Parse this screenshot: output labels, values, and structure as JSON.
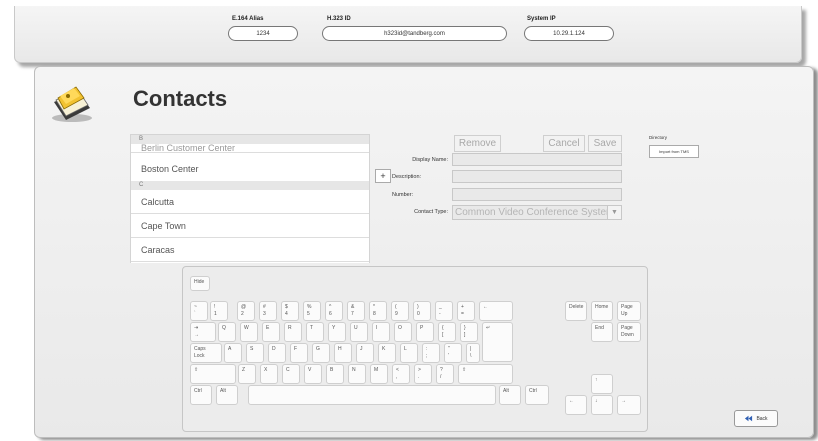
{
  "info_bar": {
    "e164_label": "E.164 Alias",
    "e164_value": "1234",
    "h323_label": "H.323 ID",
    "h323_value": "h323id@tandberg.com",
    "system_ip_label": "System IP",
    "system_ip_value": "10.29.1.124"
  },
  "page": {
    "title": "Contacts",
    "icon": "contacts-book-icon"
  },
  "contact_list": {
    "rows": [
      {
        "kind": "header",
        "text": "B"
      },
      {
        "kind": "item",
        "text": "Berlin Customer Center"
      },
      {
        "kind": "item",
        "text": "Boston Center"
      },
      {
        "kind": "header",
        "text": "C"
      },
      {
        "kind": "item",
        "text": "Calcutta"
      },
      {
        "kind": "item",
        "text": "Cape Town"
      },
      {
        "kind": "item",
        "text": "Caracas"
      }
    ]
  },
  "form": {
    "remove_label": "Remove",
    "cancel_label": "Cancel",
    "save_label": "Save",
    "add_label": "+",
    "display_name_label": "Display Name:",
    "display_name_value": "",
    "description_label": "Description:",
    "description_value": "",
    "number_label": "Number:",
    "number_value": "",
    "contact_type_label": "Contact Type:",
    "contact_type_value": "Common Video Conference System"
  },
  "directory": {
    "label": "Directory",
    "import_label": "Import from TMS"
  },
  "keyboard": {
    "hide_label": "Hide",
    "rows": [
      [
        "~\n`",
        "!\n1",
        "@\n2",
        "#\n3",
        "$\n4",
        "%\n5",
        "^\n6",
        "&\n7",
        "*\n8",
        "(\n9",
        ")\n0",
        "_\n-",
        "+\n=",
        "←"
      ],
      [
        "⇥\n→",
        "Q",
        "W",
        "E",
        "R",
        "T",
        "Y",
        "U",
        "I",
        "O",
        "P",
        "{\n[",
        "}\n]",
        "↵"
      ],
      [
        "Caps\nLock",
        "A",
        "S",
        "D",
        "F",
        "G",
        "H",
        "J",
        "K",
        "L",
        ":\n;",
        "\"\n'",
        "|\n\\"
      ],
      [
        "⇧",
        "Z",
        "X",
        "C",
        "V",
        "B",
        "N",
        "M",
        "<\n,",
        ">\n.",
        "?\n/",
        "⇧"
      ],
      [
        "Ctrl",
        "Alt",
        "",
        "Alt",
        "Ctrl"
      ]
    ],
    "nav": {
      "delete": "Delete",
      "home": "Home",
      "page_up": "Page\nUp",
      "end": "End",
      "page_down": "Page\nDown",
      "up": "↑",
      "left": "←",
      "down": "↓",
      "right": "→"
    }
  },
  "back_label": "Back",
  "colors": {
    "panel": "#ececec",
    "border": "#c6c6c6",
    "disabled_text": "#a8a8a8",
    "back_arrow": "#2f5fb3"
  }
}
